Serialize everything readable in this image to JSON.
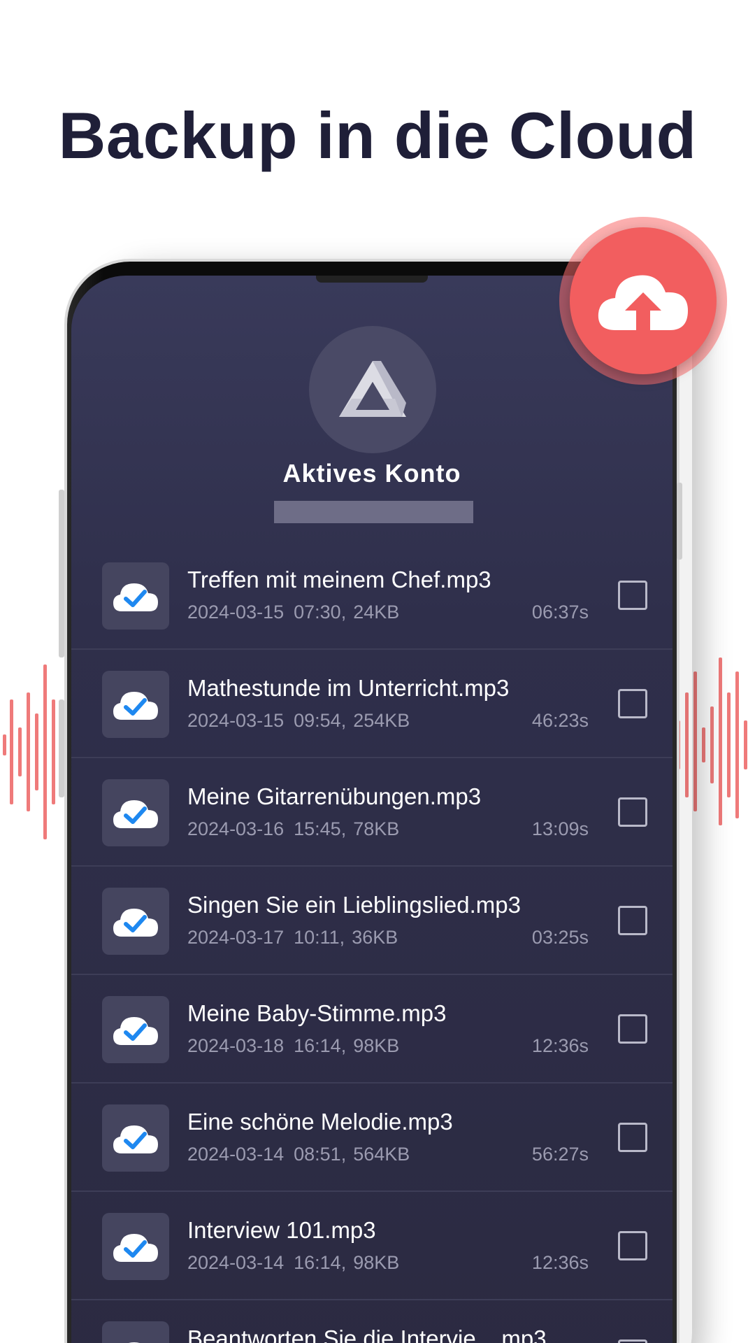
{
  "headline": "Backup in die Cloud",
  "account": {
    "label": "Aktives Konto",
    "icon": "google-drive-icon"
  },
  "upload_icon": "cloud-upload-icon",
  "colors": {
    "accent": "#f25e5f",
    "screen_bg": "#2f2f4b",
    "check_blue": "#1e88f0"
  },
  "recordings": [
    {
      "name": "Treffen mit meinem Chef.mp3",
      "date": "2024-03-15",
      "time": "07:30,",
      "size": "24KB",
      "duration": "06:37s"
    },
    {
      "name": "Mathestunde im Unterricht.mp3",
      "date": "2024-03-15",
      "time": "09:54,",
      "size": "254KB",
      "duration": "46:23s"
    },
    {
      "name": "Meine Gitarrenübungen.mp3",
      "date": "2024-03-16",
      "time": "15:45,",
      "size": "78KB",
      "duration": "13:09s"
    },
    {
      "name": "Singen Sie ein Lieblingslied.mp3",
      "date": "2024-03-17",
      "time": "10:11,",
      "size": "36KB",
      "duration": "03:25s"
    },
    {
      "name": "Meine Baby-Stimme.mp3",
      "date": "2024-03-18",
      "time": "16:14,",
      "size": "98KB",
      "duration": "12:36s"
    },
    {
      "name": "Eine schöne Melodie.mp3",
      "date": "2024-03-14",
      "time": "08:51,",
      "size": "564KB",
      "duration": "56:27s"
    },
    {
      "name": "Interview 101.mp3",
      "date": "2024-03-14",
      "time": "16:14,",
      "size": "98KB",
      "duration": "12:36s"
    },
    {
      "name": "Beantworten Sie die Intervie....mp3",
      "date": "",
      "time": "",
      "size": "",
      "duration": ""
    }
  ]
}
